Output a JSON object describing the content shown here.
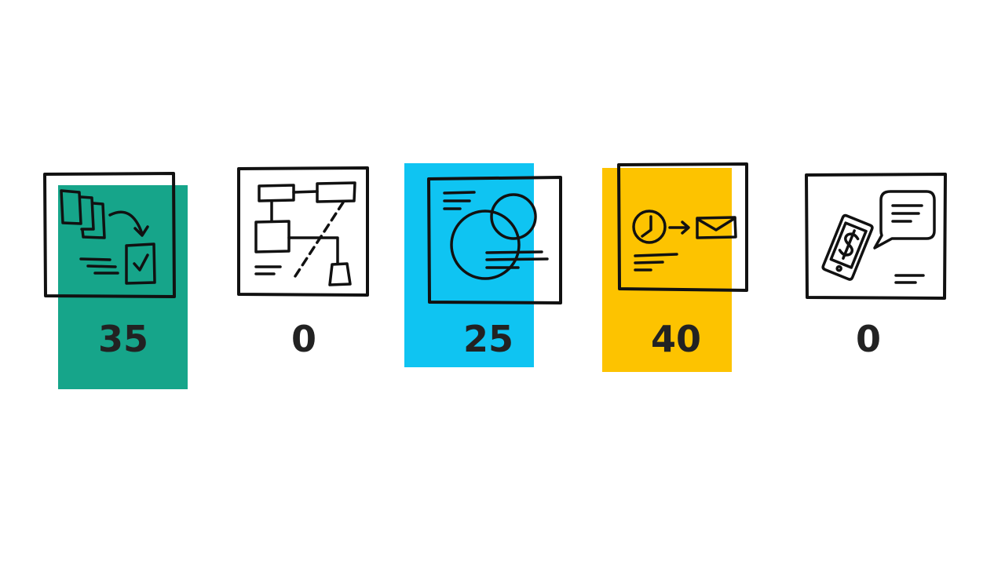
{
  "cards": [
    {
      "value": "35",
      "icon": "documents-to-checklist-icon",
      "highlight": "#16a58a"
    },
    {
      "value": "0",
      "icon": "flowchart-icon",
      "highlight": null
    },
    {
      "value": "25",
      "icon": "venn-circles-icon",
      "highlight": "#0fc4f2"
    },
    {
      "value": "40",
      "icon": "clock-to-email-icon",
      "highlight": "#fdc300"
    },
    {
      "value": "0",
      "icon": "mobile-payment-chat-icon",
      "highlight": null
    }
  ]
}
